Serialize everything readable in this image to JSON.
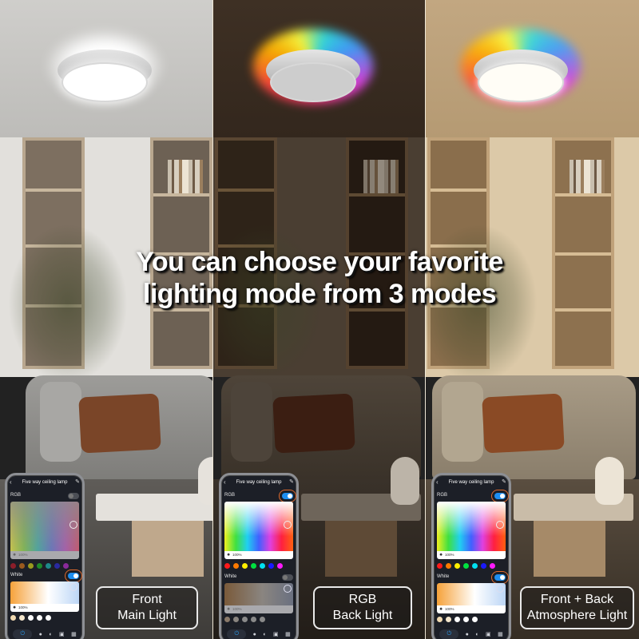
{
  "headline": {
    "line1": "You can choose your favorite",
    "line2": "lighting mode from 3 modes"
  },
  "modes": [
    {
      "label_line1": "Front",
      "label_line2": "Main Light",
      "theme": {
        "ceiling": "#c9c8c6",
        "wall": "#dedcd8",
        "wood": "#8d7d6a",
        "sofa": "#8e8d8a",
        "pillow": "#7a4528",
        "floor": "#5a5855",
        "glow": "#ffffff"
      },
      "lamp_state": "front-on",
      "app": {
        "title": "Five way ceiling lamp",
        "rgb_label": "RGB",
        "rgb_toggle": "off",
        "rgb_brightness": "100%",
        "rgb_brightness_active": false,
        "rgb_swatches": [
          "#8b1e2a",
          "#9a5a1e",
          "#9a9a1e",
          "#1e8a2a",
          "#1e8a8a",
          "#2a2aa0",
          "#8a2a9a"
        ],
        "white_label": "White",
        "white_toggle": "on",
        "white_brightness": "100%",
        "white_brightness_active": true,
        "white_swatches": [
          "#f0d9b0",
          "#f4e6cc",
          "#ffffff",
          "#ffffff",
          "#ffffff"
        ],
        "highlighted_toggle": "white"
      }
    },
    {
      "label_line1": "RGB",
      "label_line2": "Back Light",
      "theme": {
        "ceiling": "#3a2c22",
        "wall": "#4a3c30",
        "wood": "#3a2b1e",
        "sofa": "#4a3f35",
        "pillow": "#3b1e12",
        "floor": "#2e2822",
        "glow": "rainbow"
      },
      "lamp_state": "back-rgb-on",
      "app": {
        "title": "Five way ceiling lamp",
        "rgb_label": "RGB",
        "rgb_toggle": "on",
        "rgb_brightness": "100%",
        "rgb_brightness_active": true,
        "rgb_swatches": [
          "#ff1a1a",
          "#ff7a00",
          "#ffee00",
          "#00e040",
          "#00e0f0",
          "#1a1aff",
          "#ff1aff"
        ],
        "white_label": "White",
        "white_toggle": "off",
        "white_brightness": "100%",
        "white_brightness_active": false,
        "white_swatches": [
          "#8a7a6a",
          "#8a8580",
          "#8a8a8a",
          "#8a8a8a",
          "#8a8a8a"
        ],
        "highlighted_toggle": "rgb"
      }
    },
    {
      "label_line1": "Front + Back",
      "label_line2": "Atmosphere Light",
      "theme": {
        "ceiling": "#bda27b",
        "wall": "#d8c4a3",
        "wood": "#9a7d58",
        "sofa": "#9b8f7c",
        "pillow": "#8a4a25",
        "floor": "#4c4236",
        "glow": "rainbow"
      },
      "lamp_state": "front-and-back-on",
      "app": {
        "title": "Five way ceiling lamp",
        "rgb_label": "RGB",
        "rgb_toggle": "on",
        "rgb_brightness": "100%",
        "rgb_brightness_active": true,
        "rgb_swatches": [
          "#ff1a1a",
          "#ff7a00",
          "#ffee00",
          "#00e040",
          "#00e0f0",
          "#1a1aff",
          "#ff1aff"
        ],
        "white_label": "White",
        "white_toggle": "on",
        "white_brightness": "100%",
        "white_brightness_active": true,
        "white_swatches": [
          "#f0d9b0",
          "#f4e6cc",
          "#ffffff",
          "#ffffff",
          "#ffffff"
        ],
        "highlighted_toggle": "both"
      }
    }
  ],
  "app_icons": {
    "back": "chevron-left-icon",
    "edit": "edit-icon",
    "nav": [
      "power-icon",
      "bulb-icon",
      "palette-icon",
      "scene-icon",
      "grid-icon"
    ]
  },
  "accent": {
    "toggle_on": "#1e8ef0",
    "highlight_ring": "#e06a2c"
  }
}
